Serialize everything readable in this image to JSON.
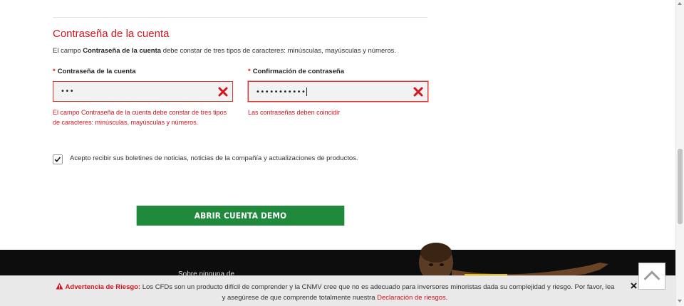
{
  "section": {
    "title": "Contraseña de la cuenta",
    "desc_pre": "El campo ",
    "desc_bold": "Contraseña de la cuenta",
    "desc_post": " debe constar de tres tipos de caracteres: minúsculas, mayúsculas y números."
  },
  "password": {
    "required_mark": "*",
    "label": "Contraseña de la cuenta",
    "value": "•••",
    "error_line1": "El campo Contraseña de la cuenta debe constar de tres tipos",
    "error_line2": "de caracteres: minúsculas, mayúsculas y números."
  },
  "confirm": {
    "required_mark": "*",
    "label": "Confirmación de contraseña",
    "value": "•••••••••••",
    "error": "Las contraseñas deben coincidir"
  },
  "newsletter": {
    "checked": true,
    "label": "Acepto recibir sus boletines de noticias, noticias de la compañía y actualizaciones de productos."
  },
  "cta": {
    "label": "ABRIR CUENTA DEMO"
  },
  "footer": {
    "partial_text": "Sobre ninguna de..."
  },
  "risk": {
    "title": "Advertencia de Riesgo:",
    "text_line1": " Los CFDs son un producto difícil de comprender y la CNMV cree que no es adecuado para inversores minoristas dada su complejidad y riesgo. Por favor, lea",
    "text_line2": "y asegúrese de que comprende totalmente nuestra ",
    "link": "Declaración de riesgos",
    "end": "."
  },
  "colors": {
    "accent": "#d4141e",
    "cta": "#1f8a3c",
    "footer": "#0d0d0d",
    "risk_bar": "#e9e9e9"
  },
  "icons": {
    "invalid": "x-icon",
    "warning": "warning-icon",
    "close": "close-icon",
    "back_to_top": "chevron-up-icon",
    "checkbox": "check-icon"
  }
}
